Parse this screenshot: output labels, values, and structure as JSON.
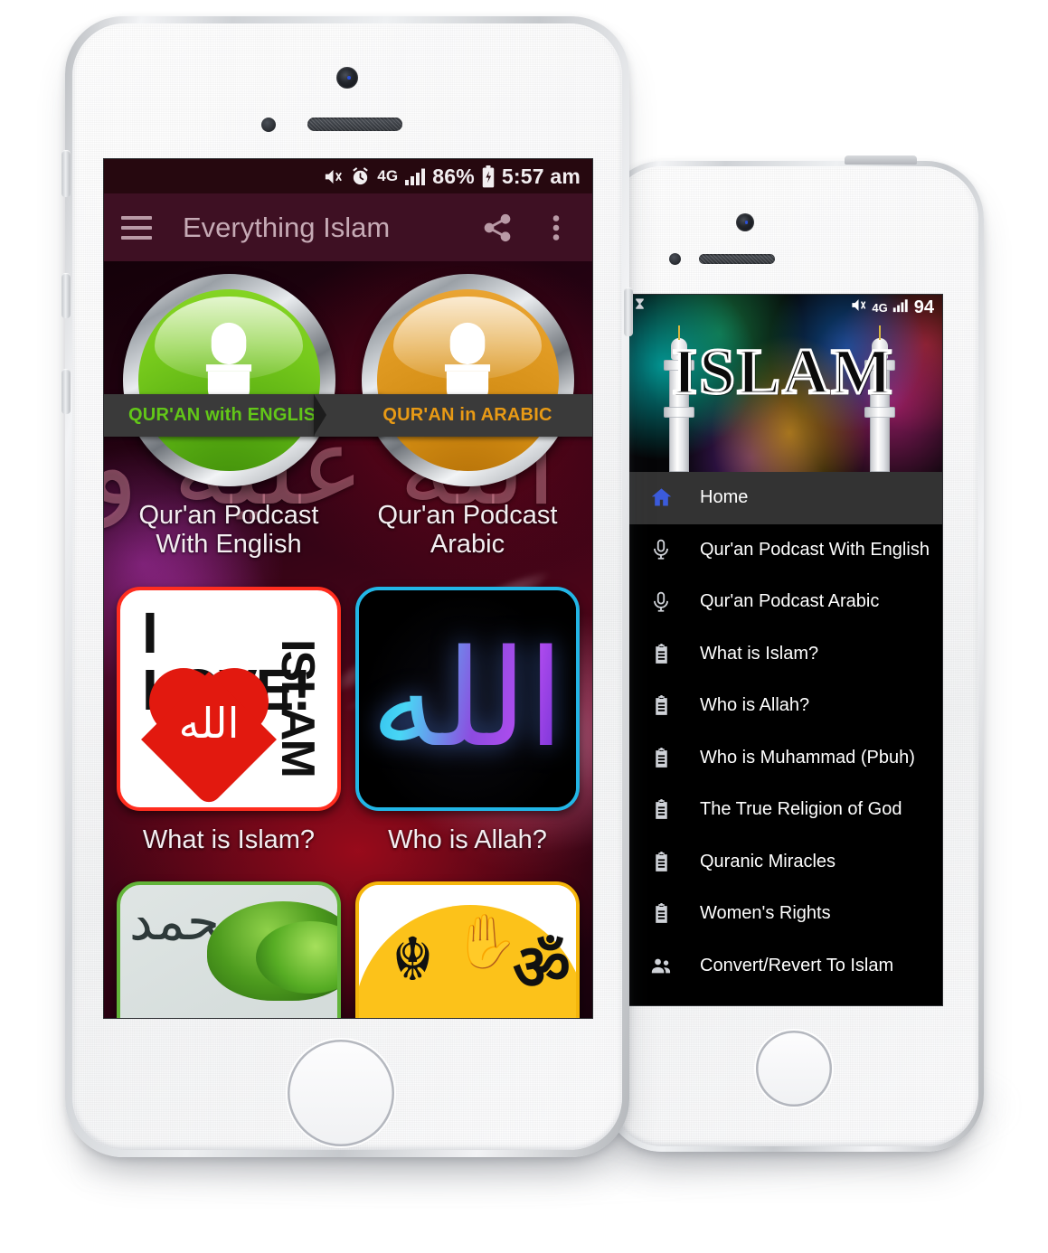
{
  "left_phone": {
    "status_bar": {
      "icons": [
        "mute-icon",
        "alarm-icon",
        "4g-icon",
        "signal-icon"
      ],
      "network": "4G",
      "battery_percent": "86%",
      "time": "5:57 am"
    },
    "app_bar": {
      "menu_icon": "hamburger-icon",
      "title": "Everything Islam",
      "share_icon": "share-icon",
      "overflow_icon": "more-vertical-icon"
    },
    "grid": [
      {
        "type": "mic",
        "ribbon": "QUR'AN with ENGLISH",
        "ribbon_color": "#62c718",
        "badge_color": "#76c91c",
        "label": "Qur'an Podcast\nWith English",
        "label_line1": "Qur'an Podcast",
        "label_line2": "With English"
      },
      {
        "type": "mic",
        "ribbon": "QUR'AN in ARABIC",
        "ribbon_color": "#e89a15",
        "badge_color": "#e09a22",
        "label_line1": "Qur'an Podcast",
        "label_line2": "Arabic"
      },
      {
        "type": "ilove",
        "art_text_1": "I LOVE!",
        "art_text_2": "ISLAM",
        "art_calligraphy": "الله",
        "border_color": "#ff2d1f",
        "label_line1": "What is Islam?",
        "label_line2": ""
      },
      {
        "type": "allah",
        "art_calligraphy": "الله",
        "border_color": "#22b6e6",
        "label_line1": "Who is Allah?",
        "label_line2": ""
      },
      {
        "type": "tree",
        "art_calligraphy": "محمد",
        "border_color": "#62b43a",
        "label_line1": "",
        "label_line2": ""
      },
      {
        "type": "religions",
        "symbols": [
          "☬",
          "✋",
          "ॐ"
        ],
        "border_color": "#f5b60b",
        "label_line1": "",
        "label_line2": ""
      }
    ],
    "background_calligraphy": "صلى الله عليه وسلم"
  },
  "right_phone": {
    "status_bar": {
      "hourglass_icon": "hourglass-icon",
      "icons": [
        "mute-icon",
        "4g-icon",
        "signal-icon"
      ],
      "network": "4G",
      "battery": "94"
    },
    "drawer_header": {
      "title": "ISLAM",
      "decor": [
        "minaret-left",
        "minaret-right"
      ]
    },
    "menu_items": [
      {
        "icon": "home-icon",
        "label": "Home",
        "active": true
      },
      {
        "icon": "microphone-icon",
        "label": "Qur'an Podcast With English",
        "active": false
      },
      {
        "icon": "microphone-icon",
        "label": "Qur'an Podcast Arabic",
        "active": false
      },
      {
        "icon": "clipboard-icon",
        "label": "What is Islam?",
        "active": false
      },
      {
        "icon": "clipboard-icon",
        "label": "Who is Allah?",
        "active": false
      },
      {
        "icon": "clipboard-icon",
        "label": "Who is Muhammad (Pbuh)",
        "active": false
      },
      {
        "icon": "clipboard-icon",
        "label": "The True Religion of God",
        "active": false
      },
      {
        "icon": "clipboard-icon",
        "label": "Quranic Miracles",
        "active": false
      },
      {
        "icon": "clipboard-icon",
        "label": "Women's Rights",
        "active": false
      },
      {
        "icon": "people-icon",
        "label": "Convert/Revert To Islam",
        "active": false
      }
    ]
  },
  "colors": {
    "status_bar": "#26080f",
    "app_bar": "#3e1023",
    "app_bar_text": "#c6aab5",
    "drawer_bg": "#000000",
    "drawer_active": "#333333",
    "home_icon": "#3b5bdb",
    "page_bg": "#ffffff"
  }
}
